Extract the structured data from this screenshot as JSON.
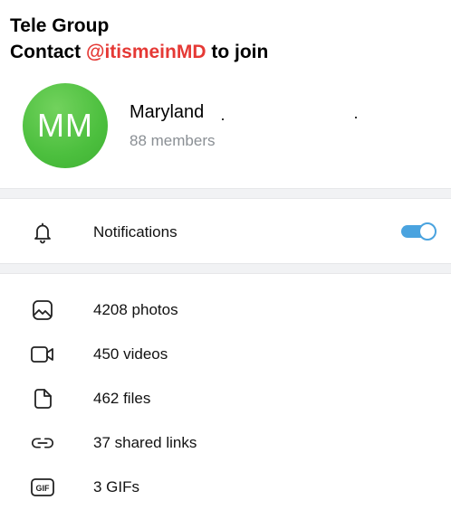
{
  "banner": {
    "line1": "Tele Group",
    "line2_prefix": "Contact ",
    "line2_handle": "@itismeinMD",
    "line2_suffix": " to join"
  },
  "group": {
    "initials": "MM",
    "name": "Maryland",
    "members": "88 members"
  },
  "notifications": {
    "label": "Notifications",
    "enabled": true
  },
  "media": [
    {
      "label": "4208 photos",
      "icon": "photo-icon"
    },
    {
      "label": "450 videos",
      "icon": "video-icon"
    },
    {
      "label": "462 files",
      "icon": "file-icon"
    },
    {
      "label": "37 shared links",
      "icon": "link-icon"
    },
    {
      "label": "3 GIFs",
      "icon": "gif-icon"
    }
  ],
  "colors": {
    "accent": "#4aa3df",
    "avatar": "#4cbf3e",
    "handle": "#e53935"
  }
}
